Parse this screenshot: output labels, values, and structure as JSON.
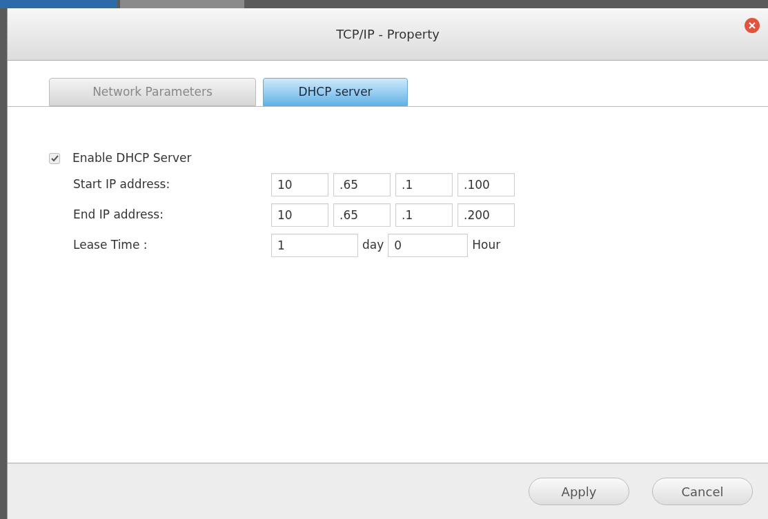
{
  "window": {
    "title": "TCP/IP - Property"
  },
  "tabs": [
    {
      "label": "Network Parameters",
      "selected": false
    },
    {
      "label": "DHCP server",
      "selected": true
    }
  ],
  "enable": {
    "label": "Enable DHCP Server",
    "checked": true
  },
  "rows": [
    {
      "kind": "ip",
      "label": "Start IP address:",
      "parts": [
        "10",
        ".65",
        ".1",
        ".100"
      ]
    },
    {
      "kind": "ip",
      "label": "End IP address:",
      "parts": [
        "10",
        ".65",
        ".1",
        ".200"
      ]
    },
    {
      "kind": "lease",
      "label": "Lease Time :",
      "days": "1",
      "day_unit": "day",
      "hours": "0",
      "hour_unit": "Hour"
    }
  ],
  "buttons": [
    "Apply",
    "Cancel"
  ]
}
